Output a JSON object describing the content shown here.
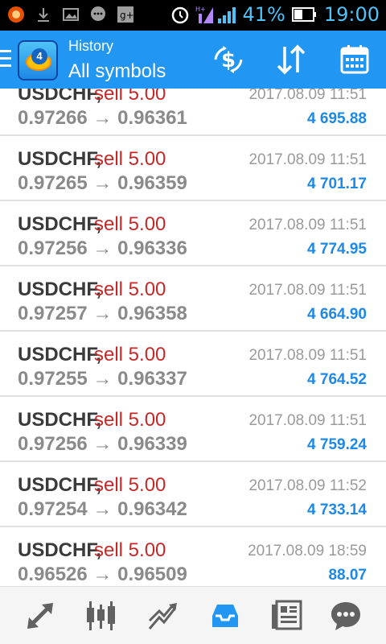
{
  "status_bar": {
    "battery": "41%",
    "time": "19:00",
    "network": "H+"
  },
  "app_bar": {
    "title": "History",
    "subtitle": "All symbols",
    "actions": [
      "exchange-icon",
      "sort-icon",
      "calendar-icon"
    ]
  },
  "trades": [
    {
      "symbol": "USDCHF,",
      "side": "sell 5.00",
      "prices": "0.97266 → 0.96361",
      "time": "2017.08.09 11:51",
      "profit": "4 695.88"
    },
    {
      "symbol": "USDCHF,",
      "side": "sell 5.00",
      "prices": "0.97265 → 0.96359",
      "time": "2017.08.09 11:51",
      "profit": "4 701.17"
    },
    {
      "symbol": "USDCHF,",
      "side": "sell 5.00",
      "prices": "0.97256 → 0.96336",
      "time": "2017.08.09 11:51",
      "profit": "4 774.95"
    },
    {
      "symbol": "USDCHF,",
      "side": "sell 5.00",
      "prices": "0.97257 → 0.96358",
      "time": "2017.08.09 11:51",
      "profit": "4 664.90"
    },
    {
      "symbol": "USDCHF,",
      "side": "sell 5.00",
      "prices": "0.97255 → 0.96337",
      "time": "2017.08.09 11:51",
      "profit": "4 764.52"
    },
    {
      "symbol": "USDCHF,",
      "side": "sell 5.00",
      "prices": "0.97256 → 0.96339",
      "time": "2017.08.09 11:51",
      "profit": "4 759.24"
    },
    {
      "symbol": "USDCHF,",
      "side": "sell 5.00",
      "prices": "0.97254 → 0.96342",
      "time": "2017.08.09 11:52",
      "profit": "4 733.14"
    },
    {
      "symbol": "USDCHF,",
      "side": "sell 5.00",
      "prices": "0.96526 → 0.96509",
      "time": "2017.08.09 18:59",
      "profit": "88.07"
    }
  ],
  "bottom_nav": {
    "items": [
      "quotes-icon",
      "chart-icon",
      "trade-icon",
      "history-icon",
      "news-icon",
      "chat-icon"
    ],
    "active": "history-icon",
    "active_color": "#2196f3",
    "inactive_color": "#616161"
  },
  "colors": {
    "accent": "#2196f3",
    "sell": "#c62828",
    "profit": "#1e88e5"
  }
}
